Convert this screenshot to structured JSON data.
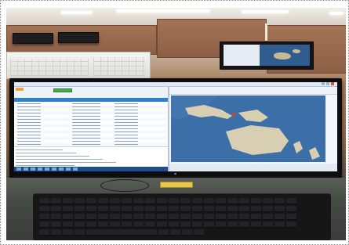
{
  "scene": {
    "kind": "control-room-photo",
    "colors": {
      "wall_wood": "#a47355",
      "screen_window": "#e8eef6",
      "table_header": "#2d7fd0",
      "map_ocean": "#3c6ea8",
      "map_land": "#d8cfb3",
      "taskbar": "#1d4f8f",
      "orange_tab": "#f2a23a",
      "green_button": "#4ea84c",
      "marker": "#e23a2e"
    }
  },
  "main_monitor": {
    "left_pane": {
      "table_row_count": 14,
      "log_line_count": 6,
      "taskbar_item_count": 9
    },
    "right_pane": {
      "map_icon": "world-map-icon",
      "marker_icon": "location-marker-icon"
    }
  },
  "background_monitor": {
    "map_icon": "world-map-icon"
  },
  "keyboard": {
    "icon": "keyboard-icon",
    "row_count": 5
  }
}
